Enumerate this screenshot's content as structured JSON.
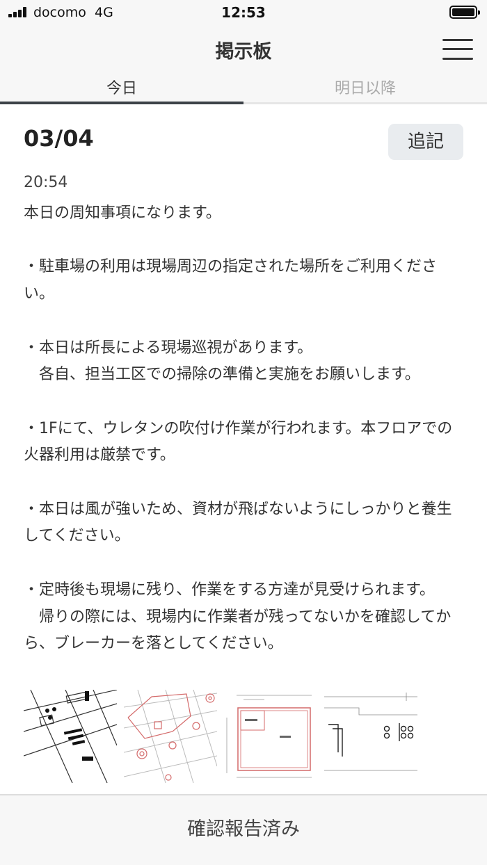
{
  "status_bar": {
    "carrier": "docomo",
    "network": "4G",
    "time": "12:53"
  },
  "header": {
    "title": "掲示板",
    "menu_icon": "hamburger-menu-icon"
  },
  "tabs": [
    {
      "label": "今日",
      "active": true
    },
    {
      "label": "明日以降",
      "active": false
    }
  ],
  "post": {
    "date": "03/04",
    "append_label": "追記",
    "time": "20:54",
    "body": "本日の周知事項になります。\n\n・駐車場の利用は現場周辺の指定された場所をご利用ください。\n\n・本日は所長による現場巡視があります。\n　各自、担当工区での掃除の準備と実施をお願いします。\n\n・1Fにて、ウレタンの吹付け作業が行われます。本フロアでの火器利用は厳禁です。\n\n・本日は風が強いため、資材が飛ばないようにしっかりと養生してください。\n\n・定時後も現場に残り、作業をする方達が見受けられます。\n　帰りの際には、現場内に作業者が残ってないかを確認してから、ブレーカーを落としてください。",
    "attachments": [
      {
        "icon": "blueprint-thumbnail-icon"
      },
      {
        "icon": "blueprint-thumbnail-icon"
      },
      {
        "icon": "floorplan-thumbnail-icon"
      },
      {
        "icon": "blueprint-thumbnail-icon"
      }
    ]
  },
  "footer": {
    "confirm_label": "確認報告済み"
  },
  "colors": {
    "active_tab_underline": "#3d4248",
    "inactive_tab_text": "#aaaaaa",
    "button_bg": "#e9ecef",
    "bar_bg": "#f7f7f7"
  }
}
